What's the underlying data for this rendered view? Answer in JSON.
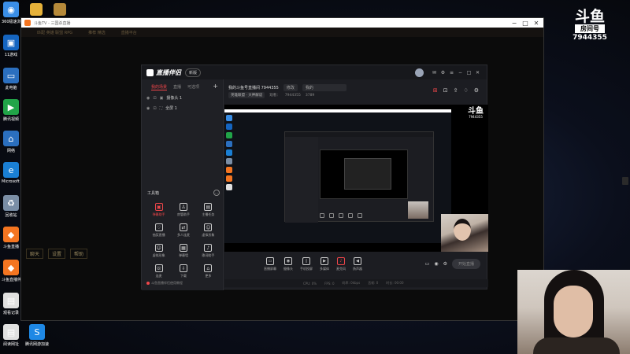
{
  "desktop": {
    "icons": [
      {
        "label": "360极速浏览",
        "name": "browser-360-icon",
        "color": "#3a8ee6",
        "glyph": "◉"
      },
      {
        "label": "11游戏",
        "name": "game-11-icon",
        "color": "#1565c0",
        "glyph": "▣"
      },
      {
        "label": "此电脑",
        "name": "computer-icon",
        "color": "#2b6fbf",
        "glyph": "▭"
      },
      {
        "label": "腾讯视频",
        "name": "tencent-video-icon",
        "color": "#21a448",
        "glyph": "▶"
      },
      {
        "label": "网络",
        "name": "network-icon",
        "color": "#2b6fbf",
        "glyph": "⌂"
      },
      {
        "label": "Microsoft Edge",
        "name": "edge-icon",
        "color": "#1a7fd4",
        "glyph": "e"
      },
      {
        "label": "回收站",
        "name": "recycle-bin-icon",
        "color": "#7a8ea6",
        "glyph": "♻"
      },
      {
        "label": "斗鱼直播",
        "name": "douyu-live-icon",
        "color": "#f47521",
        "glyph": "◆"
      },
      {
        "label": "斗鱼直播伴侣",
        "name": "douyu-companion-icon",
        "color": "#f47521",
        "glyph": "◆"
      },
      {
        "label": "观看记录",
        "name": "watch-history-icon",
        "color": "#e0e0e0",
        "glyph": "▤"
      },
      {
        "label": "阅读网址",
        "name": "read-url-icon",
        "color": "#e0e0e0",
        "glyph": "▤"
      }
    ],
    "extra_top_icons": [
      {
        "name": "folder-icon",
        "color": "#e6b23a"
      },
      {
        "name": "league-icon",
        "color": "#b68a3a"
      }
    ],
    "extra_bottom_icon": {
      "label": "腾讯网游加速器",
      "name": "tencent-accelerator-icon",
      "color": "#1e88e5"
    }
  },
  "outer_window": {
    "title": "斗鱼TV - 三国杀直播",
    "nav": [
      "匹配 英雄 联盟 RPG",
      "推荐 精选",
      "直播平台"
    ],
    "bottom_buttons": [
      "聊天",
      "设置",
      "帮助"
    ]
  },
  "companion": {
    "brand": "直播伴侣",
    "version": "新版",
    "left_tabs": [
      "我的场景",
      "直播",
      "可选项"
    ],
    "scenes": [
      "摄像头 1",
      "全屏 1"
    ],
    "tools_title": "工具箱",
    "tools": [
      {
        "label": "弹幕助手",
        "glyph": "▣",
        "red": true
      },
      {
        "label": "房管助手",
        "glyph": "♙",
        "red": false
      },
      {
        "label": "主播任务",
        "glyph": "▤",
        "red": false
      },
      {
        "label": "抽奖直播",
        "glyph": "♡",
        "red": false
      },
      {
        "label": "多人连麦",
        "glyph": "⇄",
        "red": false
      },
      {
        "label": "虚拟形象",
        "glyph": "☺",
        "red": false
      },
      {
        "label": "虚拟形象",
        "glyph": "☺",
        "red": false
      },
      {
        "label": "弹幕墙",
        "glyph": "▦",
        "red": false
      },
      {
        "label": "歌词助手",
        "glyph": "♪",
        "red": false
      },
      {
        "label": "连麦",
        "glyph": "☏",
        "red": false
      },
      {
        "label": "下载",
        "glyph": "⇩",
        "red": false
      },
      {
        "label": "更多",
        "glyph": "⌂",
        "red": false
      }
    ],
    "footer": "斗鱼直播伴侣使用教程",
    "room_title": "我的斗鱼号直播间 7944355",
    "id_label": "修改",
    "room_field": "我的",
    "category": "英雄联盟 · 大神解说",
    "stats": [
      "观看：",
      "7944355",
      "3789"
    ],
    "preview_logo_top": "斗鱼",
    "preview_logo_bottom": "7944355",
    "controls": [
      {
        "label": "直播屏幕",
        "glyph": "▭",
        "red": false
      },
      {
        "label": "摄像头",
        "glyph": "◉",
        "red": false
      },
      {
        "label": "手机投屏",
        "glyph": "▯",
        "red": false
      },
      {
        "label": "多媒体",
        "glyph": "▶",
        "red": false
      },
      {
        "label": "麦克风",
        "glyph": "♪",
        "red": true
      },
      {
        "label": "扬声器",
        "glyph": "◀",
        "red": false
      }
    ],
    "go_live": "开始直播",
    "status_bar": [
      "CPU: 0%",
      "FPS: 0",
      "码率: 0kbps",
      "丢帧: 0",
      "时长: 00:00"
    ]
  },
  "watermark": {
    "logo": "斗鱼",
    "subtitle": "房间号",
    "room_number": "7944355"
  }
}
